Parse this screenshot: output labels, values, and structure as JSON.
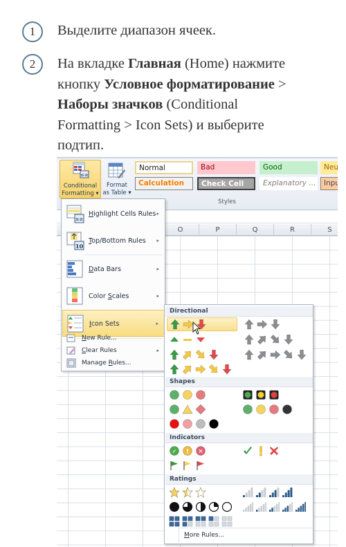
{
  "instructions": {
    "steps": [
      {
        "number": "1",
        "text": "Выделите диапазон ячеек."
      },
      {
        "number": "2",
        "line1_pre": "На вкладке ",
        "line1_bold": "Главная",
        "line1_post": " (Home) нажмите",
        "line2_pre": "кнопку ",
        "line2_bold": "Условное форматирование",
        "line2_post": " >",
        "line3_bold": "Наборы значков",
        "line3_post": " (Conditional",
        "line4": "Formatting > Icon Sets) и выберите",
        "line5": "подтип."
      }
    ]
  },
  "ribbon": {
    "conditional_formatting": {
      "line1": "Conditional",
      "line2": "Formatting ▾"
    },
    "format_as_table": {
      "line1": "Format",
      "line2": "as Table ▾"
    },
    "styles": {
      "group_label": "Styles",
      "cells": [
        {
          "label": "Normal",
          "bg": "#ffffff",
          "border": "#e8d48a",
          "color": "#222222"
        },
        {
          "label": "Bad",
          "bg": "#ffc7ce",
          "border": "#ffc7ce",
          "color": "#9c0006"
        },
        {
          "label": "Good",
          "bg": "#c6efce",
          "border": "#c6efce",
          "color": "#006100"
        },
        {
          "label": "Neu",
          "bg": "#ffeb9c",
          "border": "#ffeb9c",
          "color": "#9c6500"
        },
        {
          "label": "Calculation",
          "bg": "#f2f2f2",
          "border": "#7f7f7f",
          "color": "#fa7d00"
        },
        {
          "label": "Check Cell",
          "bg": "#a5a5a5",
          "border": "#3f3f3f",
          "color": "#ffffff"
        },
        {
          "label": "Explanatory ...",
          "bg": "#ffffff",
          "border": "#ffffff",
          "color": "#7f7f7f"
        },
        {
          "label": "Inpu",
          "bg": "#ffcc99",
          "border": "#7f7f7f",
          "color": "#3f3f76"
        }
      ]
    }
  },
  "columns": [
    "O",
    "P",
    "Q",
    "R",
    "S"
  ],
  "menu": {
    "items": [
      {
        "label_u": "H",
        "label_rest": "ighlight Cells Rules",
        "has_submenu": true
      },
      {
        "label_u": "T",
        "label_rest": "op/Bottom Rules",
        "has_submenu": true
      },
      {
        "label_u": "D",
        "label_rest": "ata Bars",
        "has_submenu": true
      },
      {
        "label_pre": "Color ",
        "label_u": "S",
        "label_rest": "cales",
        "has_submenu": true
      },
      {
        "label_u": "I",
        "label_rest": "con Sets",
        "has_submenu": true,
        "active": true
      }
    ],
    "small_items": [
      {
        "label_u": "N",
        "label_rest": "ew Rule...",
        "has_submenu": false
      },
      {
        "label_u": "C",
        "label_rest": "lear Rules",
        "has_submenu": true
      },
      {
        "label_pre": "Manage ",
        "label_u": "R",
        "label_rest": "ules...",
        "has_submenu": false
      }
    ],
    "arrow": "▸"
  },
  "gallery": {
    "sections": [
      "Directional",
      "Shapes",
      "Indicators",
      "Ratings"
    ],
    "directional_selected": "3 Arrows (Colored)",
    "more_rules_u": "M",
    "more_rules_rest": "ore Rules..."
  },
  "colors": {
    "arrow_green": "#3a9a48",
    "arrow_yellow": "#f4c842",
    "arrow_red": "#e0484c",
    "arrow_gray": "#8a8d91",
    "circle_green": "#5cb06a",
    "circle_yellow": "#f4d35e",
    "circle_red": "#e57b7f",
    "circle_black": "#333333",
    "bar_blue": "#2d5b8c",
    "highlight": "#f9e08e"
  }
}
